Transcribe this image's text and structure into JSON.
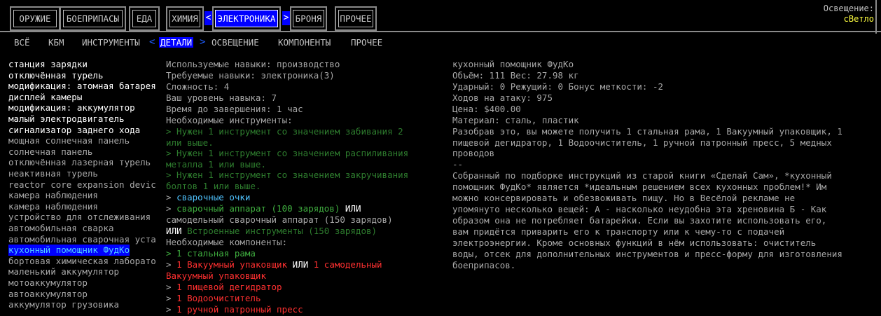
{
  "tabs": [
    {
      "label": "ОРУЖИЕ",
      "active": false
    },
    {
      "label": "БОЕПРИПАСЫ",
      "active": false
    },
    {
      "label": "ЕДА",
      "active": false
    },
    {
      "label": "ХИМИЯ",
      "active": false
    },
    {
      "label": "ЭЛЕКТРОНИКА",
      "active": true
    },
    {
      "label": "БРОНЯ",
      "active": false
    },
    {
      "label": "ПРОЧЕЕ",
      "active": false
    }
  ],
  "lighting": {
    "label": "Освещение:",
    "value": "сВетло"
  },
  "subtabs": [
    {
      "label": "ВСЁ",
      "active": false
    },
    {
      "label": "КБМ",
      "active": false
    },
    {
      "label": "ИНСТРУМЕНТЫ",
      "active": false
    },
    {
      "label": "ДЕТАЛИ",
      "active": true
    },
    {
      "label": "ОСВЕЩЕНИЕ",
      "active": false
    },
    {
      "label": "КОМПОНЕНТЫ",
      "active": false
    },
    {
      "label": "ПРОЧЕЕ",
      "active": false
    }
  ],
  "chevrons": {
    "left": "<",
    "right": ">"
  },
  "recipes": [
    {
      "name": "станция зарядки",
      "available": true
    },
    {
      "name": "отключённая турель",
      "available": true
    },
    {
      "name": "модификация: атомная батарея",
      "available": true
    },
    {
      "name": "дисплей камеры",
      "available": true
    },
    {
      "name": " модификация: аккумулятор",
      "available": true
    },
    {
      "name": "малый электродвигатель",
      "available": true
    },
    {
      "name": "сигнализатор заднего хода",
      "available": true
    },
    {
      "name": "мощная солнечная панель",
      "available": false
    },
    {
      "name": "солнечная панель",
      "available": false
    },
    {
      "name": "отключённая лазерная турель",
      "available": false
    },
    {
      "name": "неактивная турель",
      "available": false
    },
    {
      "name": "reactor core expansion devic",
      "available": false
    },
    {
      "name": "камера наблюдения",
      "available": false
    },
    {
      "name": "камера наблюдения",
      "available": false
    },
    {
      "name": "устройство для отслеживания",
      "available": false
    },
    {
      "name": "автомобильная сварка",
      "available": false
    },
    {
      "name": "автомобильная сварочная уста",
      "available": false
    },
    {
      "name": "кухонный помощник ФудКо",
      "available": false,
      "selected": true
    },
    {
      "name": "бортовая химическая лаборато",
      "available": false
    },
    {
      "name": "маленький аккумулятор",
      "available": false
    },
    {
      "name": "мотоаккумулятор",
      "available": false
    },
    {
      "name": "автоаккумулятор",
      "available": false
    },
    {
      "name": "аккумулятор грузовика",
      "available": false
    }
  ],
  "details": {
    "used_skill": "Используемые навыки: производство",
    "req_skill": "Требуемые навыки: электроника(3)",
    "difficulty": "Сложность: 4",
    "your_skill": "Ваш уровень навыка: 7",
    "time": "Время до завершения: 1 час",
    "tools_header": "Необходимые инструменты:",
    "tool1_a": "> Нужен 1 инструмент со значением забивания 2",
    "tool1_b": "  или выше.",
    "tool2_a": "> Нужен 1 инструмент со значением распиливания",
    "tool2_b": "  металла 1 или выше.",
    "tool3_a": "> Нужен 1 инструмент со значением закручивания",
    "tool3_b": "  болтов 1 или выше.",
    "tool4_arrow": ">",
    "tool4": "сварочные очки",
    "tool5_arrow": ">",
    "tool5_a": "сварочный аппарат (100 зарядов)",
    "or1": "ИЛИ",
    "tool5_b": "  самодельный сварочный аппарат (150 зарядов)",
    "or2": "  ИЛИ",
    "tool5_c": "Встроенные инструменты (150 зарядов)",
    "components_header": "Необходимые компоненты:",
    "c1": "> 1 стальная рама",
    "c2_arrow": ">",
    "c2_a": "1 Вакуумный упаковщик",
    "or3": "ИЛИ",
    "c2_b": "1 самодельный",
    "c2_c": "  Вакуумный упаковщик",
    "c3_arrow": ">",
    "c3": "1 пищевой дегидратор",
    "c4_arrow": ">",
    "c4": "1 Водоочиститель",
    "c5_arrow": ">",
    "c5": "1 ручной патронный пресс"
  },
  "item": {
    "name": "кухонный помощник ФудКо",
    "volume": "Объём: 111 Вес: 27.98 кг",
    "damage": "Ударный: 0 Режущий: 0 Бонус меткости: -2",
    "moves": "Ходов на атаку: 975",
    "price": "Цена: $400.00",
    "material": "Материал: сталь, пластик",
    "disassemble": [
      "Разобрав это, вы можете получить 1 стальная рама, 1 Вакуумный упаковщик, 1",
      "пищевой дегидратор, 1 Водоочиститель, 1 ручной патронный пресс, 5 медных",
      "проводов"
    ],
    "separator": "--",
    "description": [
      "Собранный по подборке инструкций из старой книги «Сделай Сам», *кухонный",
      "помощник ФудКо* является *идеальным решением всех кухонных проблем!* Им",
      "можно консервировать и обезвоживать пищу. Но в Весёлой рекламе не",
      "упомянуто несколько вещей: А - насколько неудобна эта хреновина Б - Как",
      "образом она не потребляет батарейки. Если вы захотите использовать его,",
      "вам придётся приварить его к транспорту или к чему-то с подачей",
      "электроэнергии. Кроме основных функций в нём использовать: очиститель",
      "воды, отсек для дополнительных инструментов и пресс-форму для изготовления",
      "боеприпасов."
    ]
  }
}
